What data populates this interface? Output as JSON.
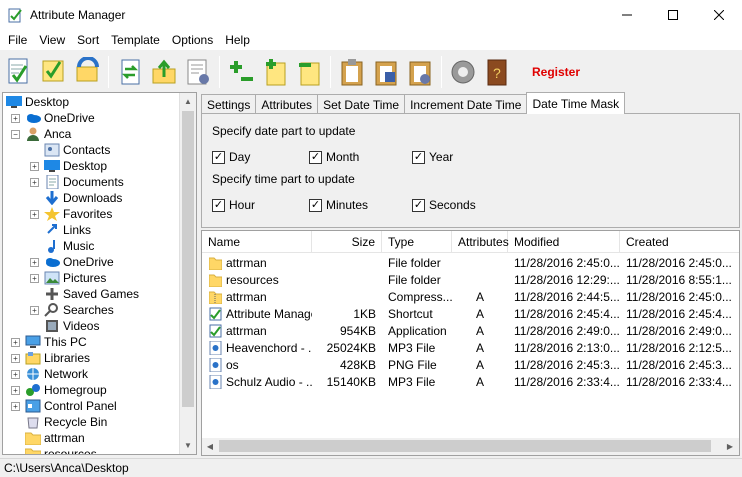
{
  "window": {
    "title": "Attribute Manager"
  },
  "menu": [
    "File",
    "View",
    "Sort",
    "Template",
    "Options",
    "Help"
  ],
  "toolbar": {
    "buttons": [
      "apply-attributes-icon",
      "edit-attributes-icon",
      "refresh-icon",
      "switch-icon",
      "up-folder-icon",
      "settings-list-icon",
      "add-remove-icon",
      "add-template-icon",
      "remove-template-icon",
      "clipboard-icon",
      "save-icon",
      "clipboard-settings-icon",
      "gear-icon",
      "help-book-icon"
    ],
    "register_label": "Register"
  },
  "tree": {
    "items": [
      {
        "label": "Desktop",
        "icon": "desktop-icon"
      },
      {
        "label": "OneDrive",
        "icon": "cloud-icon"
      },
      {
        "label": "Anca",
        "icon": "user-icon"
      },
      {
        "label": "Contacts",
        "icon": "contacts-icon"
      },
      {
        "label": "Desktop",
        "icon": "desktop-icon"
      },
      {
        "label": "Documents",
        "icon": "documents-icon"
      },
      {
        "label": "Downloads",
        "icon": "download-icon"
      },
      {
        "label": "Favorites",
        "icon": "star-icon"
      },
      {
        "label": "Links",
        "icon": "link-icon"
      },
      {
        "label": "Music",
        "icon": "music-icon"
      },
      {
        "label": "OneDrive",
        "icon": "cloud-icon"
      },
      {
        "label": "Pictures",
        "icon": "pictures-icon"
      },
      {
        "label": "Saved Games",
        "icon": "games-icon"
      },
      {
        "label": "Searches",
        "icon": "search-icon"
      },
      {
        "label": "Videos",
        "icon": "video-icon"
      },
      {
        "label": "This PC",
        "icon": "computer-icon"
      },
      {
        "label": "Libraries",
        "icon": "libraries-icon"
      },
      {
        "label": "Network",
        "icon": "network-icon"
      },
      {
        "label": "Homegroup",
        "icon": "homegroup-icon"
      },
      {
        "label": "Control Panel",
        "icon": "control-panel-icon"
      },
      {
        "label": "Recycle Bin",
        "icon": "recycle-bin-icon"
      },
      {
        "label": "attrman",
        "icon": "folder-icon"
      },
      {
        "label": "resources",
        "icon": "folder-icon"
      }
    ]
  },
  "tabs": [
    "Settings",
    "Attributes",
    "Set Date Time",
    "Increment Date Time",
    "Date Time Mask"
  ],
  "active_tab": "Date Time Mask",
  "mask": {
    "date_label": "Specify date part to update",
    "time_label": "Specify time part to update",
    "date_parts": [
      {
        "label": "Day",
        "checked": true
      },
      {
        "label": "Month",
        "checked": true
      },
      {
        "label": "Year",
        "checked": true
      }
    ],
    "time_parts": [
      {
        "label": "Hour",
        "checked": true
      },
      {
        "label": "Minutes",
        "checked": true
      },
      {
        "label": "Seconds",
        "checked": true
      }
    ]
  },
  "files": {
    "columns": [
      "Name",
      "Size",
      "Type",
      "Attributes",
      "Modified",
      "Created"
    ],
    "rows": [
      {
        "name": "attrman",
        "size": "",
        "type": "File folder",
        "attr": "",
        "modified": "11/28/2016 2:45:0...",
        "created": "11/28/2016 2:45:0...",
        "icon": "folder-icon"
      },
      {
        "name": "resources",
        "size": "",
        "type": "File folder",
        "attr": "",
        "modified": "11/28/2016 12:29:...",
        "created": "11/28/2016 8:55:1...",
        "icon": "folder-icon"
      },
      {
        "name": "attrman",
        "size": "",
        "type": "Compress...",
        "attr": "A",
        "modified": "11/28/2016 2:44:5...",
        "created": "11/28/2016 2:45:0...",
        "icon": "zip-folder-icon"
      },
      {
        "name": "Attribute Manager",
        "size": "1KB",
        "type": "Shortcut",
        "attr": "A",
        "modified": "11/28/2016 2:45:4...",
        "created": "11/28/2016 2:45:4...",
        "icon": "shortcut-icon"
      },
      {
        "name": "attrman",
        "size": "954KB",
        "type": "Application",
        "attr": "A",
        "modified": "11/28/2016 2:49:0...",
        "created": "11/28/2016 2:49:0...",
        "icon": "app-icon"
      },
      {
        "name": "Heavenchord - ...",
        "size": "25024KB",
        "type": "MP3 File",
        "attr": "A",
        "modified": "11/28/2016 2:13:0...",
        "created": "11/28/2016 2:12:5...",
        "icon": "mp3-icon"
      },
      {
        "name": "os",
        "size": "428KB",
        "type": "PNG File",
        "attr": "A",
        "modified": "11/28/2016 2:45:3...",
        "created": "11/28/2016 2:45:3...",
        "icon": "png-icon"
      },
      {
        "name": "Schulz Audio - ...",
        "size": "15140KB",
        "type": "MP3 File",
        "attr": "A",
        "modified": "11/28/2016 2:33:4...",
        "created": "11/28/2016 2:33:4...",
        "icon": "mp3-icon"
      }
    ]
  },
  "status": {
    "path": "C:\\Users\\Anca\\Desktop"
  },
  "colors": {
    "accent": "#0078d7",
    "register": "#e00000"
  }
}
